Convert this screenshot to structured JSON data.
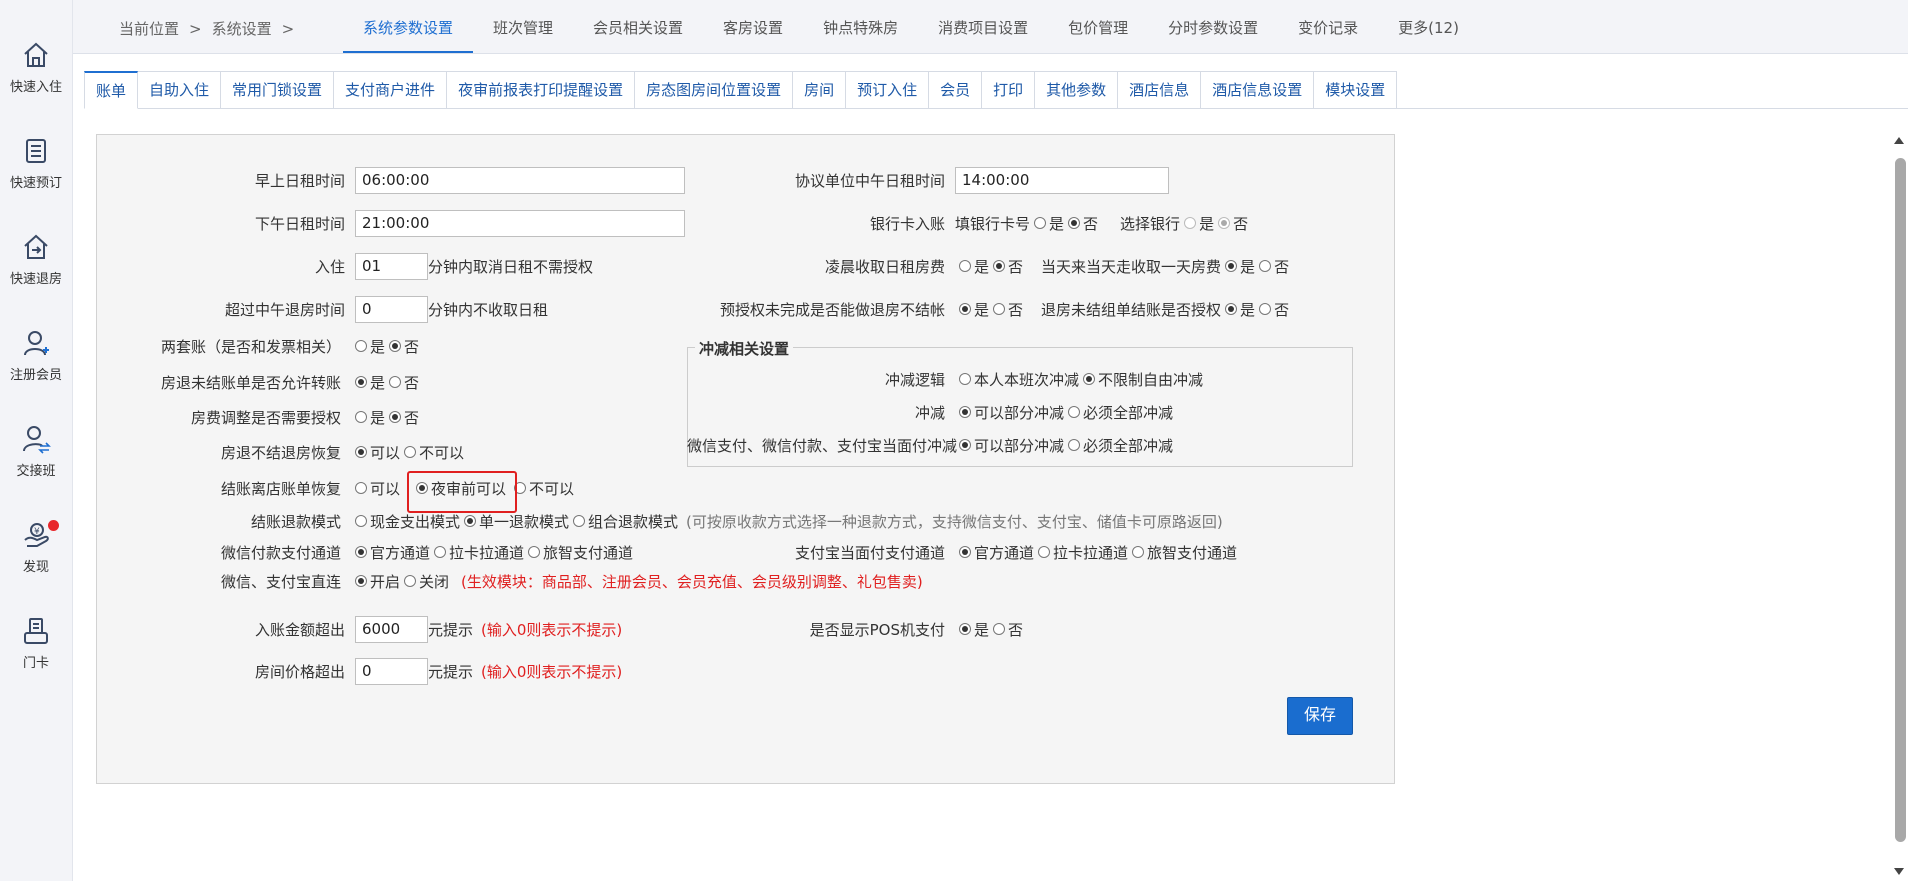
{
  "sidebar": {
    "items": [
      {
        "label": "快速入住",
        "icon": "home-icon"
      },
      {
        "label": "快速预订",
        "icon": "document-icon"
      },
      {
        "label": "快速退房",
        "icon": "checkout-house-icon"
      },
      {
        "label": "注册会员",
        "icon": "add-user-icon"
      },
      {
        "label": "交接班",
        "icon": "shift-handover-icon"
      },
      {
        "label": "发现",
        "icon": "discover-icon"
      },
      {
        "label": "门卡",
        "icon": "card-machine-icon"
      }
    ]
  },
  "breadcrumb": {
    "location": "当前位置",
    "sep": ">",
    "section": "系统设置",
    "sep2": ">"
  },
  "top_tabs": [
    "系统参数设置",
    "班次管理",
    "会员相关设置",
    "客房设置",
    "钟点特殊房",
    "消费项目设置",
    "包价管理",
    "分时参数设置",
    "变价记录",
    "更多(12)"
  ],
  "sub_tabs": [
    "账单",
    "自助入住",
    "常用门锁设置",
    "支付商户进件",
    "夜审前报表打印提醒设置",
    "房态图房间位置设置",
    "房间",
    "预订入住",
    "会员",
    "打印",
    "其他参数",
    "酒店信息",
    "酒店信息设置",
    "模块设置"
  ],
  "form": {
    "morning_rent_label": "早上日租时间",
    "morning_rent_value": "06:00:00",
    "afternoon_rent_label": "下午日租时间",
    "afternoon_rent_value": "21:00:00",
    "checkin_label": "入住",
    "checkin_value": "01",
    "checkin_suffix": "分钟内取消日租不需授权",
    "noon_checkout_label": "超过中午退房时间",
    "noon_checkout_value": "0",
    "noon_checkout_suffix": "分钟内不收取日租",
    "two_accounts_label": "两套账（是否和发票相关）",
    "refund_transfer_label": "房退未结账单是否允许转账",
    "room_fee_adjust_label": "房费调整是否需要授权",
    "room_restore_label": "房退不结退房恢复",
    "checkout_restore_label": "结账离店账单恢复",
    "refund_mode_label": "结账退款模式",
    "refund_mode_opt1": "现金支出模式",
    "refund_mode_opt2": "单一退款模式",
    "refund_mode_opt3": "组合退款模式",
    "refund_mode_note": "(可按原收款方式选择一种退款方式，支持微信支付、支付宝、储值卡可原路返回)",
    "wechat_channel_label": "微信付款支付通道",
    "channel_opt1": "官方通道",
    "channel_opt2": "拉卡拉通道",
    "channel_opt3": "旅智支付通道",
    "direct_label": "微信、支付宝直连",
    "direct_on": "开启",
    "direct_off": "关闭",
    "direct_note": "(生效模块：商品部、注册会员、会员充值、会员级别调整、礼包售卖)",
    "amount_exceed_label": "入账金额超出",
    "amount_exceed_value": "6000",
    "prompt_suffix": "元提示",
    "zero_note": "(输入0则表示不提示)",
    "price_exceed_label": "房间价格超出",
    "price_exceed_value": "0",
    "agreement_noon_label": "协议单位中午日租时间",
    "agreement_noon_value": "14:00:00",
    "bank_card_label": "银行卡入账",
    "bank_card_no_label": "填银行卡号",
    "select_bank_label": "选择银行",
    "early_rent_label": "凌晨收取日租房费",
    "same_day_label": "当天来当天走收取一天房费",
    "preauth_label": "预授权未完成是否能做退房不结帐",
    "group_checkout_label": "退房未结组单结账是否授权",
    "offset_legend": "冲减相关设置",
    "offset_logic_label": "冲减逻辑",
    "offset_logic_opt1": "本人本班次冲减",
    "offset_logic_opt2": "不限制自由冲减",
    "offset_label": "冲减",
    "offset_opt1": "可以部分冲减",
    "offset_opt2": "必须全部冲减",
    "wechat_alipay_offset_label": "微信支付、微信付款、支付宝当面付冲减",
    "alipay_channel_label": "支付宝当面付支付通道",
    "pos_label": "是否显示POS机支付",
    "yes": "是",
    "no": "否",
    "can": "可以",
    "cannot": "不可以",
    "before_audit": "夜审前可以",
    "save": "保存"
  },
  "colors": {
    "accent": "#1f6fd1",
    "highlight": "#e02020",
    "save_button": "#1a6dcf"
  }
}
